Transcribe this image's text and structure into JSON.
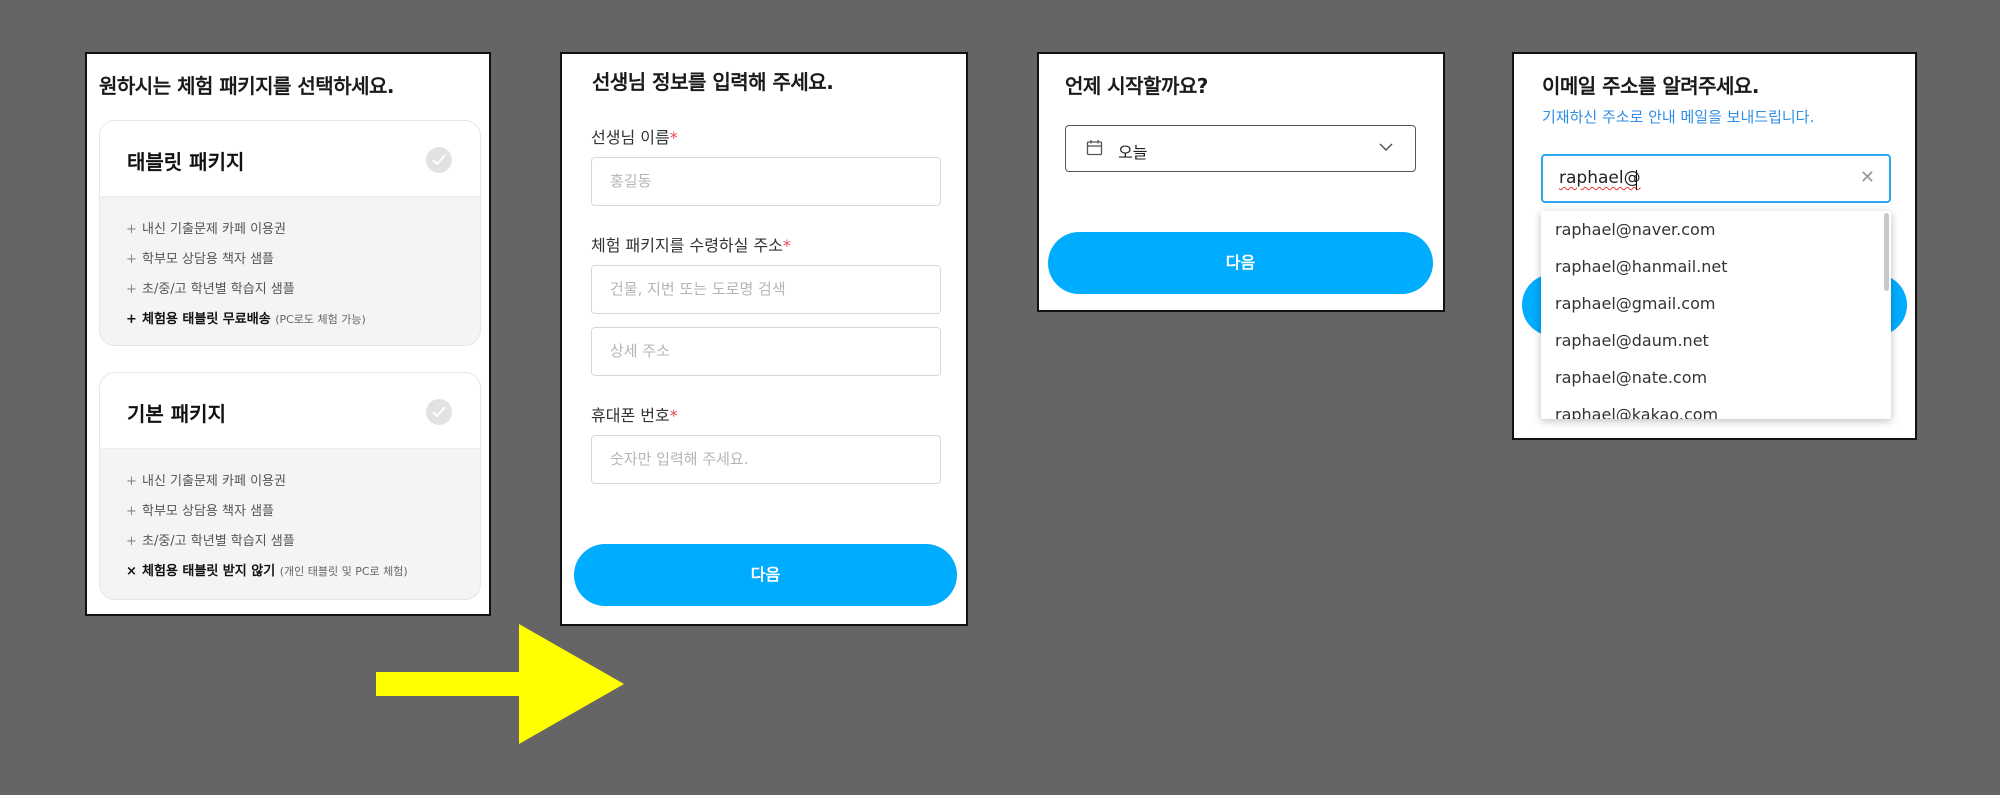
{
  "package_step": {
    "title": "원하시는 체험 패키지를 선택하세요.",
    "packages": [
      {
        "name": "태블릿 패키지",
        "items": [
          {
            "mark": "+",
            "text": "내신 기출문제 카페 이용권",
            "note": ""
          },
          {
            "mark": "+",
            "text": "학부모 상담용 책자 샘플",
            "note": ""
          },
          {
            "mark": "+",
            "text": "초/중/고 학년별 학습지 샘플",
            "note": ""
          },
          {
            "mark": "+",
            "text": "체험용 태블릿 무료배송",
            "note": "(PC로도 체험 가능)"
          }
        ]
      },
      {
        "name": "기본 패키지",
        "items": [
          {
            "mark": "+",
            "text": "내신 기출문제 카페 이용권",
            "note": ""
          },
          {
            "mark": "+",
            "text": "학부모 상담용 책자 샘플",
            "note": ""
          },
          {
            "mark": "+",
            "text": "초/중/고 학년별 학습지 샘플",
            "note": ""
          },
          {
            "mark": "×",
            "text": "체험용 태블릿 받지 않기",
            "note": "(개인 태블릿 및 PC로 체험)"
          }
        ]
      }
    ]
  },
  "info_step": {
    "title": "선생님 정보를 입력해 주세요.",
    "name_label": "선생님 이름",
    "name_placeholder": "홍길동",
    "address_label": "체험 패키지를 수령하실 주소",
    "address_placeholder": "건물, 지번 또는 도로명 검색",
    "address_detail_placeholder": "상세 주소",
    "phone_label": "휴대폰 번호",
    "phone_placeholder": "숫자만 입력해 주세요.",
    "required_mark": "*",
    "next_label": "다음"
  },
  "start_step": {
    "title": "언제 시작할까요?",
    "selected_value": "오늘",
    "next_label": "다음"
  },
  "email_step": {
    "title": "이메일 주소를 알려주세요.",
    "subtitle": "기재하신 주소로 안내 메일을 보내드립니다.",
    "input_value": "raphael@",
    "suggestions": [
      "raphael@naver.com",
      "raphael@hanmail.net",
      "raphael@gmail.com",
      "raphael@daum.net",
      "raphael@nate.com",
      "raphael@kakao.com"
    ]
  },
  "colors": {
    "background": "#656565",
    "accent_blue": "#00acfe",
    "arrow_yellow": "#ffff00",
    "required_red": "#e5484d",
    "focus_border": "#2ba8f0"
  }
}
